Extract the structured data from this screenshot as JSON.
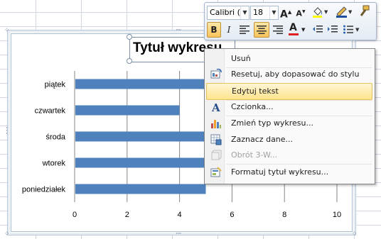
{
  "chart_data": {
    "type": "bar",
    "orientation": "horizontal",
    "title": "Tytuł wykresu",
    "categories": [
      "poniedziałek",
      "wtorek",
      "środa",
      "czwartek",
      "piątek"
    ],
    "values": [
      5,
      6,
      7,
      4,
      8
    ],
    "xlim": [
      0,
      10
    ],
    "xticks": [
      "0",
      "2",
      "4",
      "6",
      "8",
      "10"
    ],
    "grid": true,
    "bar_color": "#4f81bd"
  },
  "mini_toolbar": {
    "font_name": "Calibri (T",
    "font_size": "18",
    "grow_font": "A",
    "shrink_font": "A",
    "bold": "B",
    "italic": "I",
    "font_color_glyph": "A"
  },
  "context_menu": {
    "items": [
      {
        "label": "Usuń",
        "icon": "none",
        "disabled": false
      },
      {
        "label": "Resetuj, aby dopasować do stylu",
        "icon": "reset-style-icon",
        "disabled": false
      },
      {
        "label": "Edytuj tekst",
        "icon": "none",
        "disabled": false,
        "highlighted": true
      },
      {
        "label": "Czcionka...",
        "icon": "font-icon",
        "disabled": false
      },
      {
        "label": "Zmień typ wykresu...",
        "icon": "chart-type-icon",
        "disabled": false
      },
      {
        "label": "Zaznacz dane...",
        "icon": "select-data-icon",
        "disabled": false
      },
      {
        "label": "Obrót 3-W...",
        "icon": "rotation-3d-icon",
        "disabled": true
      },
      {
        "label": "Formatuj tytuł wykresu...",
        "icon": "format-title-icon",
        "disabled": false
      }
    ]
  },
  "colors": {
    "bar": "#4f81bd",
    "highlight": "#ffe48c",
    "font_color_underline": "#e02020",
    "highlighter": "#ffff00"
  }
}
